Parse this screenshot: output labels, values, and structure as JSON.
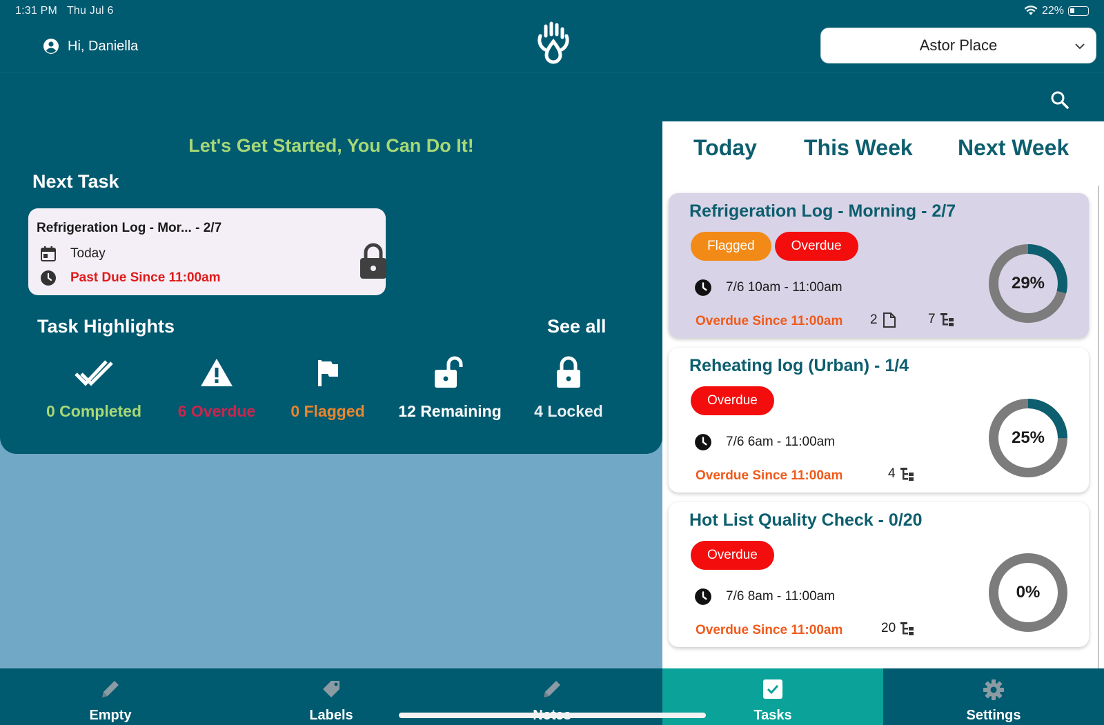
{
  "status_bar": {
    "time": "1:31 PM",
    "date": "Thu Jul 6",
    "battery": "22%"
  },
  "header": {
    "greeting": "Hi, Daniella",
    "location": "Astor Place"
  },
  "left": {
    "motivation": "Let's Get Started, You Can Do It!",
    "next_task_heading": "Next Task",
    "next_task": {
      "title": "Refrigeration Log - Mor... - 2/7",
      "date": "Today",
      "status": "Past Due Since 11:00am"
    },
    "highlights_heading": "Task Highlights",
    "see_all": "See all",
    "highlights": [
      {
        "label": "0 Completed",
        "color": "#a6d877",
        "icon": "double-check-icon"
      },
      {
        "label": "6 Overdue",
        "color": "#c8264d",
        "icon": "warning-icon"
      },
      {
        "label": "0 Flagged",
        "color": "#e8862e",
        "icon": "flag-icon"
      },
      {
        "label": "12 Remaining",
        "color": "#ffffff",
        "icon": "unlock-icon"
      },
      {
        "label": "4 Locked",
        "color": "#e6eef1",
        "icon": "lock-icon"
      }
    ]
  },
  "right": {
    "tabs": [
      "Today",
      "This Week",
      "Next Week"
    ],
    "tasks": [
      {
        "title": "Refrigeration Log - Morning - 2/7",
        "badges": [
          "Flagged",
          "Overdue"
        ],
        "time": "7/6 10am - 11:00am",
        "overdue": "Overdue Since 11:00am",
        "attachments": "2",
        "subtasks": "7",
        "percent": 0.29,
        "percent_label": "29%"
      },
      {
        "title": "Reheating log (Urban) - 1/4",
        "badges": [
          "Overdue"
        ],
        "time": "7/6 6am - 11:00am",
        "overdue": "Overdue Since 11:00am",
        "subtasks": "4",
        "percent": 0.25,
        "percent_label": "25%"
      },
      {
        "title": "Hot List Quality Check - 0/20",
        "badges": [
          "Overdue"
        ],
        "time": "7/6 8am - 11:00am",
        "overdue": "Overdue Since 11:00am",
        "subtasks": "20",
        "percent": 0.0,
        "percent_label": "0%"
      }
    ]
  },
  "bottom_nav": [
    "Empty",
    "Labels",
    "Notes",
    "Tasks",
    "Settings"
  ],
  "colors": {
    "primary": "#005a70",
    "accent": "#0aa299",
    "overdue": "#f40d0d",
    "flagged": "#f28a17",
    "title": "#0d5e6e"
  }
}
